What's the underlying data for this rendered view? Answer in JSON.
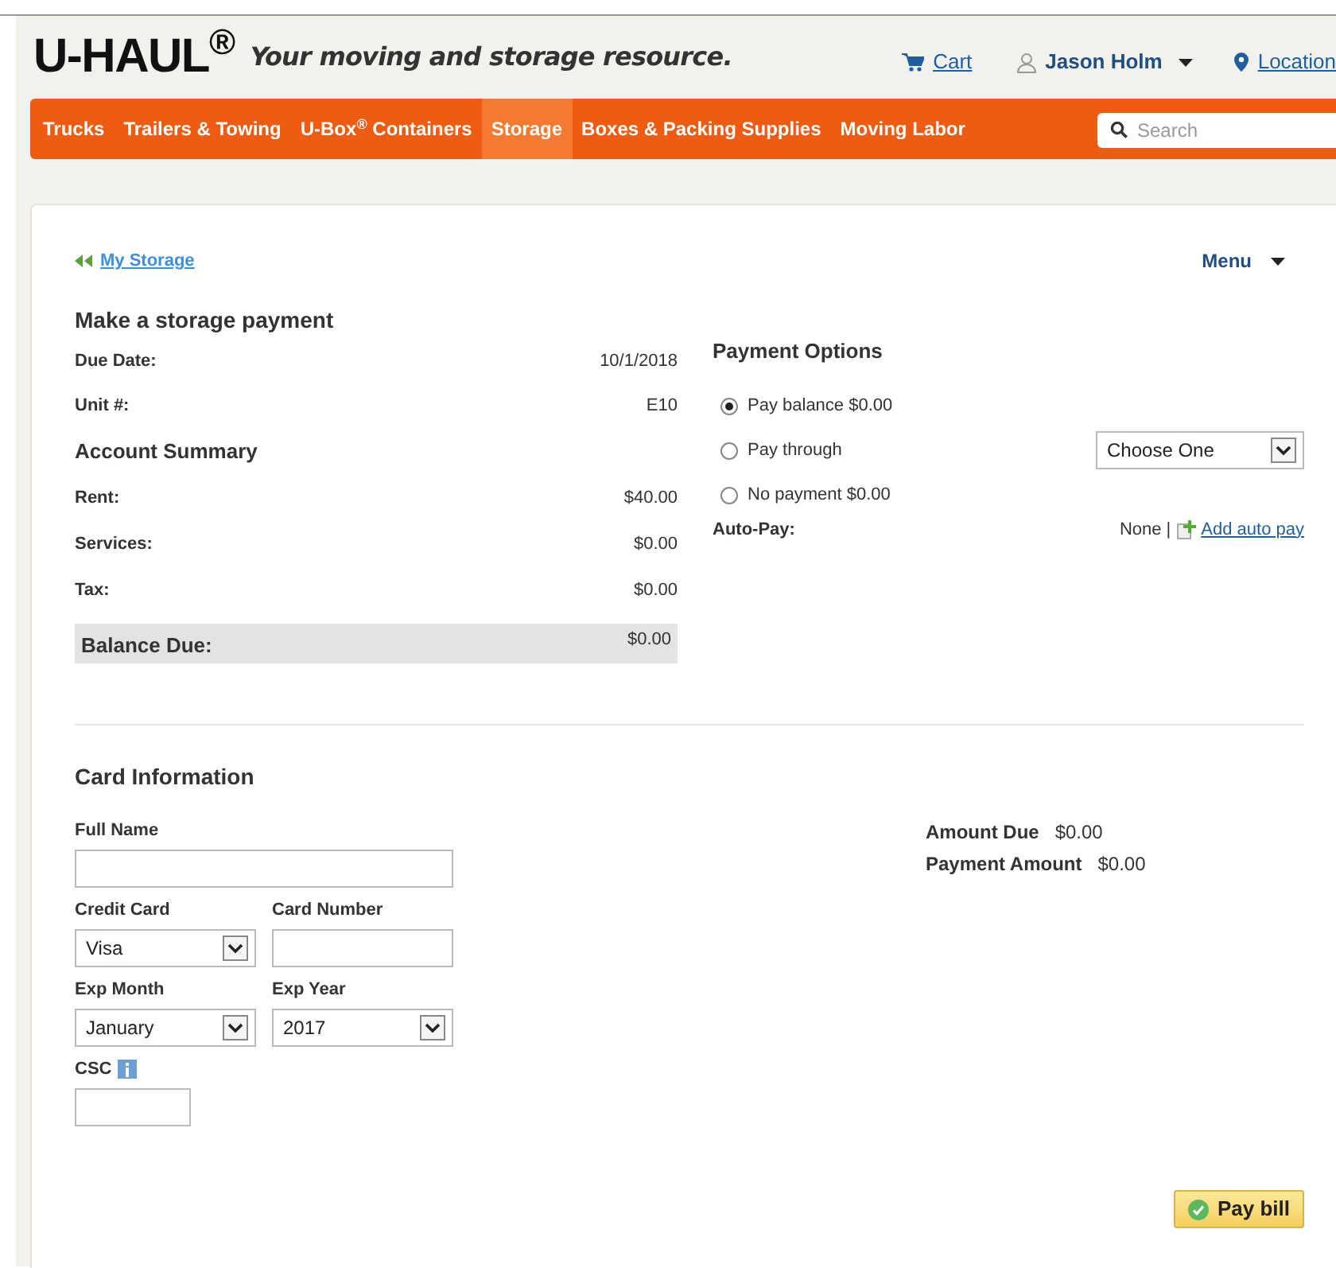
{
  "header": {
    "logo": "U-HAUL$^{®}$",
    "tagline": "Your moving and storage resource.",
    "cart": "Cart",
    "user": "Jason Holm",
    "location": "Location"
  },
  "nav": {
    "items": [
      {
        "label": "Trucks",
        "selected": false
      },
      {
        "label": "Trailers & Towing",
        "selected": false
      },
      {
        "label": "U-Box$^{®}$ Containers",
        "selected": false
      },
      {
        "label": "Storage",
        "selected": true
      },
      {
        "label": "Boxes & Packing Supplies",
        "selected": false
      },
      {
        "label": "Moving Labor",
        "selected": false
      }
    ],
    "search_placeholder": "Search"
  },
  "back_link": "My Storage",
  "menu": "Menu",
  "title": "Make a storage payment",
  "details": [
    {
      "label": "Due Date:",
      "value": "10/1/2018"
    },
    {
      "label": "Unit #:",
      "value": "E10"
    }
  ],
  "account_summary": {
    "title": "Account Summary",
    "rows": [
      {
        "label": "Rent:",
        "value": "$40.00"
      },
      {
        "label": "Services:",
        "value": "$0.00"
      },
      {
        "label": "Tax:",
        "value": "$0.00"
      }
    ],
    "balance": {
      "label": "Balance Due:",
      "value": "$0.00"
    }
  },
  "payment_options": {
    "title": "Payment Options",
    "options": [
      {
        "label": "Pay balance $0.00",
        "selected": true
      },
      {
        "label": "Pay through",
        "selected": false,
        "select": "Choose One"
      },
      {
        "label": "No payment $0.00",
        "selected": false
      }
    ],
    "auto_pay": {
      "label": "Auto-Pay:",
      "value": "None |",
      "link": "Add auto pay"
    }
  },
  "card": {
    "title": "Card Information",
    "rows": [
      [
        {
          "kind": "input",
          "label": "Full Name"
        }
      ],
      [
        {
          "kind": "select",
          "label": "Credit Card",
          "value": "Visa"
        },
        {
          "kind": "input",
          "label": "Card Number"
        }
      ],
      [
        {
          "kind": "select",
          "label": "Exp Month",
          "value": "January"
        },
        {
          "kind": "select",
          "label": "Exp Year",
          "value": "2017"
        }
      ],
      [
        {
          "kind": "input",
          "label": "CSC",
          "info": true
        }
      ]
    ]
  },
  "totals": [
    {
      "label": "Amount Due",
      "value": "$0.00"
    },
    {
      "label": "Payment Amount",
      "value": "$0.00"
    }
  ],
  "pay_button": "Pay bill"
}
